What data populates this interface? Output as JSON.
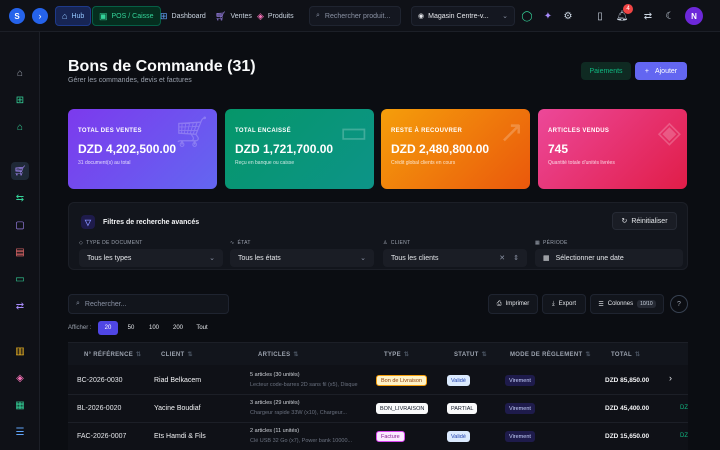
{
  "topbar": {
    "logo": "S",
    "nav": [
      {
        "label": "Hub",
        "icon": "home-icon"
      },
      {
        "label": "POS / Caisse",
        "icon": "register-icon"
      },
      {
        "label": "Dashboard",
        "icon": "grid-icon"
      },
      {
        "label": "Ventes",
        "icon": "cart-icon"
      },
      {
        "label": "Produits",
        "icon": "box-icon"
      }
    ],
    "search_placeholder": "Rechercher produit...",
    "store": "Magasin Centre-v...",
    "notifications": "4",
    "avatar": "N"
  },
  "page": {
    "title": "Bons de Commande (31)",
    "subtitle": "Gérer les commandes, devis et factures",
    "paiements": "Paiements",
    "add": "Ajouter"
  },
  "cards": [
    {
      "label": "TOTAL DES VENTES",
      "value": "DZD 4,202,500.00",
      "desc": "31 document(s) au total",
      "icon": "cart-icon"
    },
    {
      "label": "TOTAL ENCAISSÉ",
      "value": "DZD 1,721,700.00",
      "desc": "Reçu en banque ou caisse",
      "icon": "card-icon"
    },
    {
      "label": "RESTE À RECOUVRER",
      "value": "DZD 2,480,800.00",
      "desc": "Crédit global clients en cours",
      "icon": "trend-icon"
    },
    {
      "label": "ARTICLES VENDUS",
      "value": "745",
      "desc": "Quantité totale d'unités livrées",
      "icon": "box-icon"
    }
  ],
  "filters": {
    "title": "Filtres de recherche avancés",
    "reset": "Réinitialiser",
    "fields": [
      {
        "label": "TYPE DE DOCUMENT",
        "value": "Tous les types"
      },
      {
        "label": "ÉTAT",
        "value": "Tous les états"
      },
      {
        "label": "CLIENT",
        "value": "Tous les clients"
      },
      {
        "label": "PÉRIODE",
        "value": "Sélectionner une date"
      }
    ]
  },
  "toolbar": {
    "search_placeholder": "Rechercher...",
    "print": "Imprimer",
    "export": "Export",
    "columns": "Colonnes",
    "columns_count": "10/10",
    "help": "?"
  },
  "pagination": {
    "label": "Afficher :",
    "options": [
      "20",
      "50",
      "100",
      "200",
      "Tout"
    ],
    "selected": "20"
  },
  "table": {
    "headers": [
      "N° RÉFÉRENCE",
      "CLIENT",
      "ARTICLES",
      "TYPE",
      "STATUT",
      "MODE DE RÈGLEMENT",
      "TOTAL"
    ],
    "rows": [
      {
        "ref": "BC-2026-0030",
        "client": "Riad Belkacem",
        "articles": "5 articles (30 unités)",
        "articles_detail": "Lecteur code-barres 2D sans fil (x5), Disque dur...",
        "type": "Bon de Livraison",
        "statut": "Validé",
        "mode": "Virement",
        "total": "DZD 85,850.00",
        "extra": ""
      },
      {
        "ref": "BL-2026-0020",
        "client": "Yacine Boudiaf",
        "articles": "3 articles (29 unités)",
        "articles_detail": "Chargeur rapide 33W (x10), Chargeur...",
        "type": "BON_LIVRAISON",
        "statut": "PARTIAL",
        "mode": "Virement",
        "total": "DZD 45,400.00",
        "extra": "DZ"
      },
      {
        "ref": "FAC-2026-0007",
        "client": "Ets Hamdi & Fils",
        "articles": "2 articles (11 unités)",
        "articles_detail": "Clé USB 32 Go (x7), Power bank 10000...",
        "type": "Facture",
        "statut": "Validé",
        "mode": "Virement",
        "total": "DZD 15,650.00",
        "extra": "DZ"
      }
    ]
  },
  "colors": {
    "accent": "#6366f1",
    "success": "#10b981",
    "background": "#0b0d12"
  }
}
